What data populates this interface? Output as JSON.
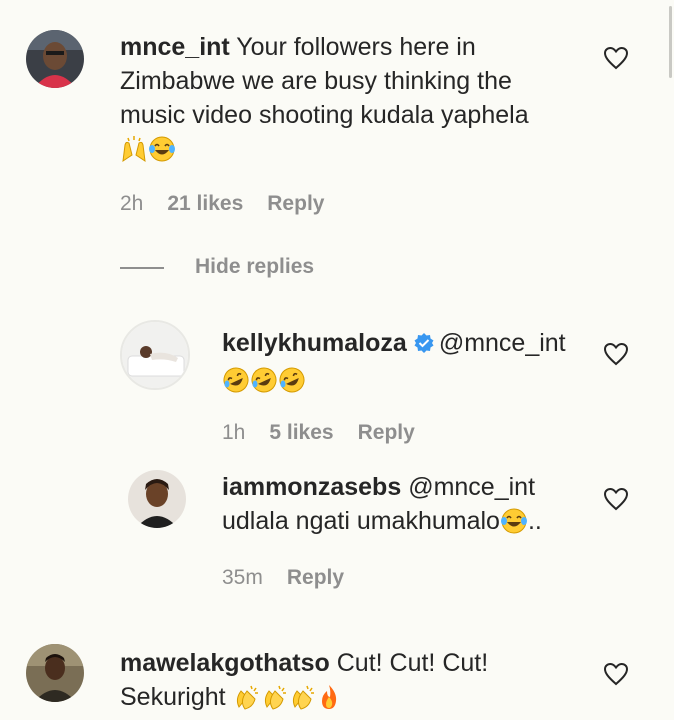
{
  "comments": [
    {
      "username": "mnce_int",
      "text_line1": "Your followers here in",
      "text_line2": "Zimbabwe we are busy thinking the",
      "text_line3": "music video shooting kudala yaphela",
      "emojis": [
        "raising-hands",
        "tears-of-joy"
      ],
      "time": "2h",
      "likes": "21 likes",
      "reply": "Reply",
      "hide_replies": "Hide replies",
      "replies": [
        {
          "username": "kellykhumaloza",
          "verified": true,
          "mention": "@mnce_int",
          "emojis": [
            "rolling-laughing",
            "rolling-laughing",
            "rolling-laughing"
          ],
          "time": "1h",
          "likes": "5 likes",
          "reply": "Reply"
        },
        {
          "username": "iammonzasebs",
          "mention": "@mnce_int",
          "text": "udlala ngati umakhumalo",
          "text_tail": "..",
          "emojis": [
            "tears-of-joy"
          ],
          "time": "35m",
          "reply": "Reply"
        }
      ]
    },
    {
      "username": "mawelakgothatso",
      "text_line1": "Cut! Cut! Cut!",
      "text_line2": "Sekuright",
      "emojis": [
        "clapping-hands",
        "clapping-hands",
        "clapping-hands",
        "fire"
      ]
    }
  ],
  "colors": {
    "background": "#fbfbf6",
    "text": "#262626",
    "muted": "#8e8e8e",
    "verified": "#3897f0"
  },
  "icons": {
    "like": "heart-outline-icon",
    "verified": "verified-badge-icon"
  }
}
